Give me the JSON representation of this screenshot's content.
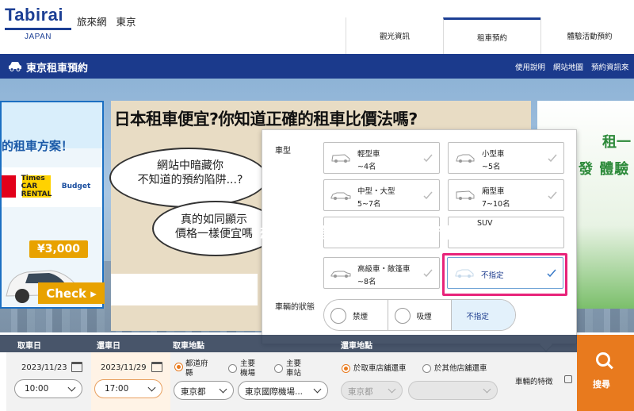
{
  "header": {
    "logo_text": "Tabirai",
    "logo_sub": "JAPAN",
    "site_name": "旅來網",
    "region": "東京",
    "nav": [
      {
        "label": "觀光資訊",
        "active": false
      },
      {
        "label": "租車預約",
        "active": true
      },
      {
        "label": "體驗活動預約",
        "active": false
      }
    ]
  },
  "bluebar": {
    "icon": "car-icon",
    "title": "東京租車預約",
    "links": [
      "使用說明",
      "網站地圖",
      "預約資訊來"
    ]
  },
  "banner": {
    "left_ad": {
      "title": "的租車方案！",
      "brands": [
        "Times CAR RENTAL",
        "Budget"
      ],
      "price": "¥3,000",
      "cta": "Check ▸"
    },
    "center_ad": {
      "title": "日本租車便宜?你知道正確的租車比價法嗎?",
      "bubble1_line1": "網站中暗藏你",
      "bubble1_line2": "不知道的預約陷阱...?",
      "bubble2_line1": "真的如同顯示",
      "bubble2_line2": "價格一樣便宜嗎"
    },
    "right_ad": {
      "line1": "租一",
      "line2": "發 體驗"
    }
  },
  "overlay": {
    "text_before": "想找最便宜方案，建議選",
    "text_highlight": "「不指定」",
    "text_after": "車型"
  },
  "popup": {
    "car_type_label": "車型",
    "car_types": [
      {
        "name": "輕型車",
        "pax": "~4名",
        "selected": false
      },
      {
        "name": "小型車",
        "pax": "~5名",
        "selected": false
      },
      {
        "name": "中型・大型",
        "pax": "5~7名",
        "selected": false
      },
      {
        "name": "廂型車",
        "pax": "7~10名",
        "selected": false
      },
      {
        "name": "SUV",
        "pax": "",
        "selected": false
      },
      {
        "name": "",
        "pax": "",
        "selected": false
      },
      {
        "name": "高級車・敞篷車",
        "pax": "~8名",
        "selected": false
      },
      {
        "name": "不指定",
        "pax": "",
        "selected": true
      }
    ],
    "state_label": "車輛的狀態",
    "states": [
      {
        "label": "禁煙",
        "icon": "no-smoking-icon"
      },
      {
        "label": "吸煙",
        "icon": "smoking-icon"
      },
      {
        "label": "不指定",
        "icon": ""
      }
    ],
    "highlight_color": "#e8237a"
  },
  "search": {
    "labels": {
      "pickup_date": "取車日",
      "return_date": "還車日",
      "pickup_place": "取車地點",
      "return_place": "還車地點"
    },
    "pickup_date": "2023/11/23",
    "pickup_time": "10:00",
    "return_date": "2023/11/29",
    "return_time": "17:00",
    "place_options": [
      {
        "label": "都道府縣",
        "checked": true
      },
      {
        "label": "主要機場",
        "checked": false
      },
      {
        "label": "主要車站",
        "checked": false
      }
    ],
    "prefecture": "東京都",
    "location": "東京國際機場...",
    "return_options": [
      {
        "label": "於取車店舖還車",
        "checked": true
      },
      {
        "label": "於其他店舖還車",
        "checked": false
      }
    ],
    "return_prefecture": "東京都",
    "features_label": "車輛的特徵",
    "search_button": "搜尋",
    "accent": "#e87a1e"
  }
}
